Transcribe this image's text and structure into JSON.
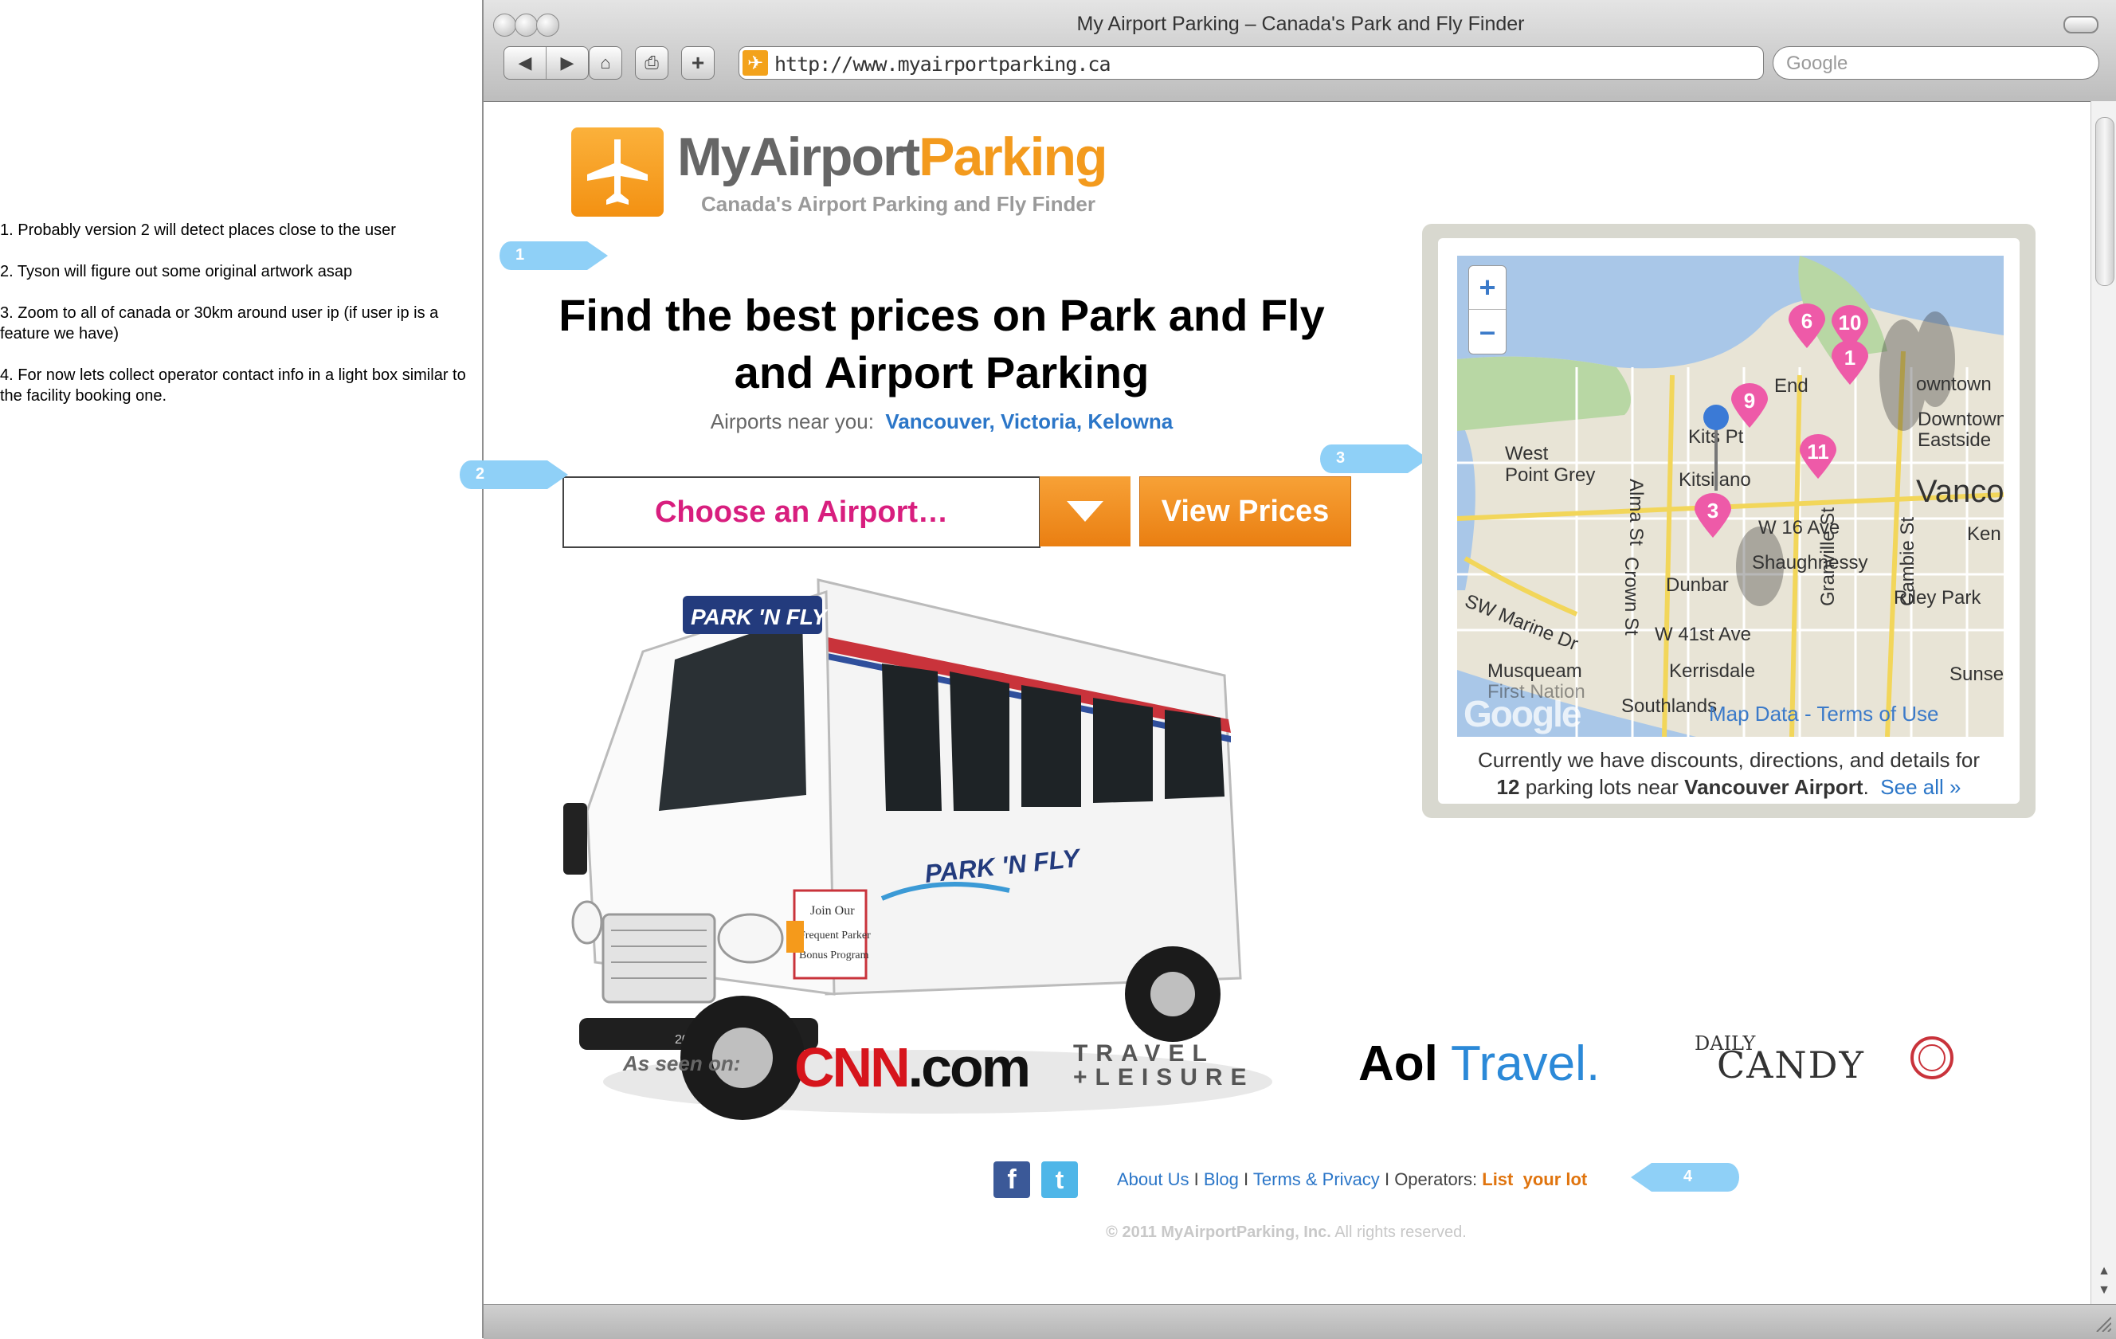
{
  "notes": [
    "1. Probably version 2 will detect places close to the user",
    "2. Tyson will figure out some original artwork asap",
    "3. Zoom to all of canada or 30km around user ip (if user ip is a feature we have)",
    "4. For now lets collect operator contact info in a light box similar to the facility booking one."
  ],
  "browser": {
    "title": "My Airport Parking – Canada's Park and Fly Finder",
    "url": "http://www.myairportparking.ca",
    "search_placeholder": "Google"
  },
  "logo": {
    "name_part1": "MyAirport",
    "name_part2": "Parking",
    "tagline": "Canada's Airport Parking and Fly Finder"
  },
  "hero": {
    "headline": "Find the best prices on Park and Fly and Airport Parking",
    "airports_label": "Airports near you:",
    "airports": [
      "Vancouver",
      "Victoria",
      "Kelowna"
    ],
    "separator": ",",
    "select_label": "Choose an Airport…",
    "view_prices": "View Prices"
  },
  "callouts": [
    "1",
    "2",
    "3",
    "4"
  ],
  "bus": {
    "brand": "PARK 'N FLY",
    "side_line1": "Join Our",
    "side_line2": "Frequent Parker",
    "side_line3": "Bonus Program",
    "plate": "2001"
  },
  "map": {
    "zoom_in": "+",
    "zoom_out": "–",
    "labels": [
      "West",
      "Point Grey",
      "Kitsilano",
      "Kits Pt",
      "Alma St",
      "W 16 Ave",
      "Shaughnessy",
      "Dunbar",
      "SW Marine Dr",
      "Crown St",
      "W 41st Ave",
      "Kerrisdale",
      "Musqueam",
      "First Nation",
      "Southlands",
      "Granville St",
      "Cambie St",
      "Riley Park",
      "Sunse",
      "Ken",
      "Vanco",
      "Downtown",
      "Eastside",
      "owntown",
      "End"
    ],
    "pins": [
      "6",
      "10",
      "1",
      "9",
      "11",
      "3"
    ],
    "google": "Google",
    "map_data": "Map Data",
    "terms": "Terms of Use",
    "caption_pre": "Currently we have discounts, directions, and details for",
    "lot_count": "12",
    "caption_mid": "parking lots near",
    "airport": "Vancouver Airport",
    "see_all": "See all »"
  },
  "as_seen_on": {
    "label": "As seen on:",
    "cnn_red": "CNN",
    "cnn_black": ".com",
    "travel": "TRAVEL",
    "leisure": "+LEISURE",
    "aol": "Aol",
    "aol_travel": "Travel.",
    "daily": "DAILY",
    "candy": "CANDY"
  },
  "footer": {
    "facebook": "f",
    "twitter": "t",
    "about": "About Us",
    "blog": "Blog",
    "terms": "Terms & Privacy",
    "operators": "Operators:",
    "list_lot": "List  your lot",
    "sep": "I",
    "copyright_brand": "© 2011 MyAirportParking, Inc.",
    "copyright_rest": "All rights reserved."
  },
  "colors": {
    "orange": "#f39a1d",
    "pink": "#d81e7e",
    "link_blue": "#2b76c8",
    "callout_blue": "#8fd0f7",
    "map_pin": "#ee5aa8"
  }
}
